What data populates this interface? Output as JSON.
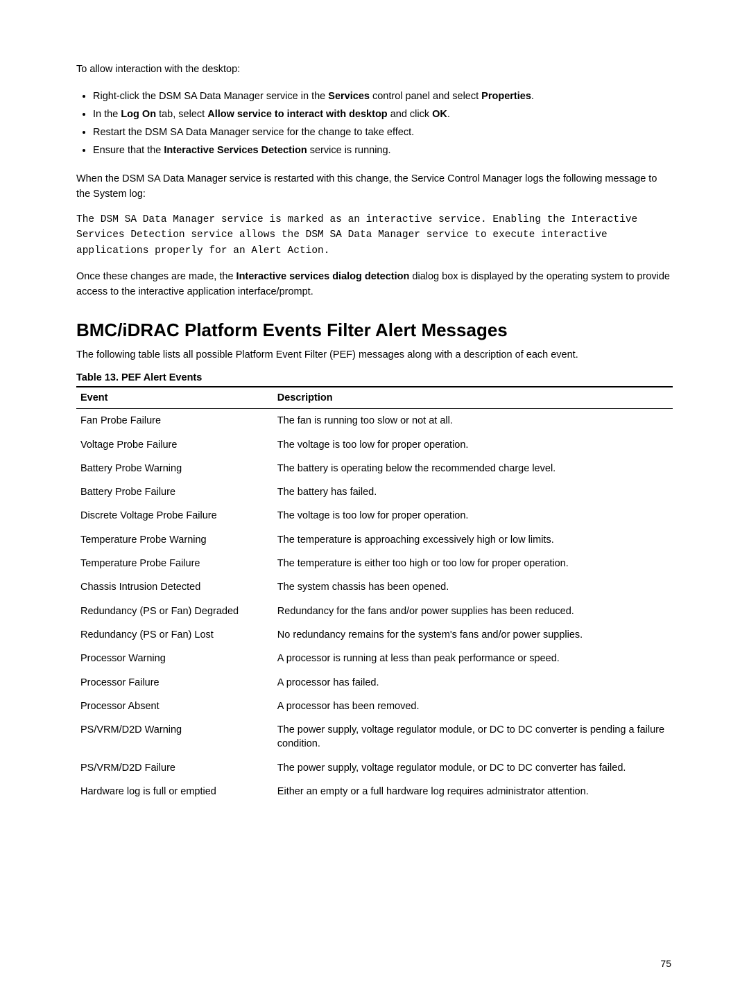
{
  "paragraphs": {
    "intro": "To allow interaction with the desktop:",
    "bullets": [
      {
        "prefix": "Right-click the DSM SA Data Manager service in the ",
        "b1": "Services",
        "mid": " control panel and select ",
        "b2": "Properties",
        "suffix": "."
      },
      {
        "prefix": "In the ",
        "b1": "Log On",
        "mid": " tab, select ",
        "b2": "Allow service to interact with desktop",
        "mid2": " and click ",
        "b3": "OK",
        "suffix": "."
      },
      {
        "text": "Restart the DSM SA Data Manager service for the change to take effect."
      },
      {
        "prefix": "Ensure that the ",
        "b1": "Interactive Services Detection",
        "suffix": " service is running."
      }
    ],
    "after_bullets": "When the DSM SA Data Manager service is restarted with this change, the Service Control Manager logs the following message to the System log:",
    "code": "The DSM SA Data Manager service is marked as an interactive service. Enabling the Interactive Services Detection service allows the DSM SA Data Manager service to execute interactive applications properly for an Alert Action.",
    "after_code_prefix": "Once these changes are made, the ",
    "after_code_b": "Interactive services dialog detection",
    "after_code_suffix": " dialog box is displayed by the operating system to provide access to the interactive application interface/prompt."
  },
  "section_heading": "BMC/iDRAC Platform Events Filter Alert Messages",
  "section_intro": "The following table lists all possible Platform Event Filter (PEF) messages along with a description of each event.",
  "table_caption": "Table 13. PEF Alert Events",
  "table": {
    "headers": {
      "event": "Event",
      "description": "Description"
    },
    "rows": [
      {
        "event": "Fan Probe Failure",
        "description": "The fan is running too slow or not at all."
      },
      {
        "event": "Voltage Probe Failure",
        "description": "The voltage is too low for proper operation."
      },
      {
        "event": "Battery Probe Warning",
        "description": "The battery is operating below the recommended charge level."
      },
      {
        "event": "Battery Probe Failure",
        "description": "The battery has failed."
      },
      {
        "event": "Discrete Voltage Probe Failure",
        "description": "The voltage is too low for proper operation."
      },
      {
        "event": "Temperature Probe Warning",
        "description": "The temperature is approaching excessively high or low limits."
      },
      {
        "event": "Temperature Probe Failure",
        "description": "The temperature is either too high or too low for proper operation."
      },
      {
        "event": "Chassis Intrusion Detected",
        "description": "The system chassis has been opened."
      },
      {
        "event": "Redundancy (PS or Fan) Degraded",
        "description": "Redundancy for the fans and/or power supplies has been reduced."
      },
      {
        "event": "Redundancy (PS or Fan) Lost",
        "description": "No redundancy remains for the system's fans and/or power supplies."
      },
      {
        "event": "Processor Warning",
        "description": "A processor is running at less than peak performance or speed."
      },
      {
        "event": "Processor Failure",
        "description": "A processor has failed."
      },
      {
        "event": "Processor Absent",
        "description": "A processor has been removed."
      },
      {
        "event": "PS/VRM/D2D Warning",
        "description": "The power supply, voltage regulator module, or DC to DC converter is pending a failure condition."
      },
      {
        "event": "PS/VRM/D2D Failure",
        "description": "The power supply, voltage regulator module, or DC to DC converter has failed."
      },
      {
        "event": "Hardware log is full or emptied",
        "description": "Either an empty or a full hardware log requires administrator attention."
      }
    ]
  },
  "page_number": "75"
}
